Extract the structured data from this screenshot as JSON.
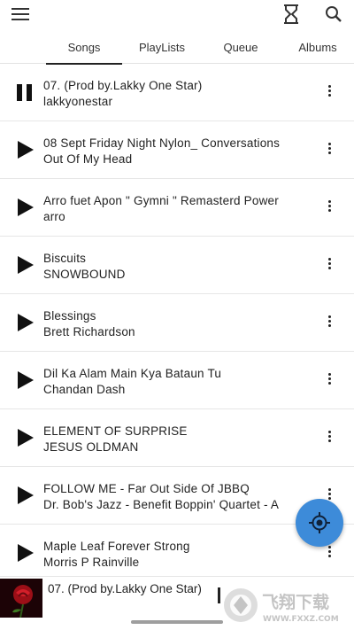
{
  "toolbar": {
    "menu_icon": "menu-icon",
    "timer_icon": "hourglass-icon",
    "search_icon": "search-icon"
  },
  "tabs": [
    {
      "label": "Songs",
      "active": true
    },
    {
      "label": "PlayLists",
      "active": false
    },
    {
      "label": "Queue",
      "active": false
    },
    {
      "label": "Albums",
      "active": false
    }
  ],
  "songs": [
    {
      "title": "07.  (Prod by.Lakky One Star)",
      "artist": "lakkyonestar",
      "state": "playing"
    },
    {
      "title": "08 Sept Friday Night Nylon_ Conversations",
      "artist": "Out Of My Head",
      "state": "paused"
    },
    {
      "title": "Arro fuet Apon \" Gymni \" Remasterd Power",
      "artist": "arro",
      "state": "paused"
    },
    {
      "title": "Biscuits",
      "artist": "SNOWBOUND",
      "state": "paused"
    },
    {
      "title": "Blessings",
      "artist": "Brett Richardson",
      "state": "paused"
    },
    {
      "title": "Dil Ka Alam Main Kya Bataun Tu",
      "artist": "Chandan Dash",
      "state": "paused"
    },
    {
      "title": "ELEMENT OF SURPRISE",
      "artist": "JESUS OLDMAN",
      "state": "paused"
    },
    {
      "title": "FOLLOW ME - Far Out Side Of JBBQ",
      "artist": "Dr. Bob's Jazz - Benefit Boppin' Quartet - A",
      "state": "paused"
    },
    {
      "title": "Maple Leaf Forever Strong",
      "artist": "Morris P Rainville",
      "state": "paused"
    }
  ],
  "now_playing": {
    "title": "07.  (Prod by.Lakky One Star)"
  },
  "fab": {
    "icon": "locate-icon",
    "color": "#3d8bd9"
  },
  "watermark": {
    "brand": "飞翔下载",
    "url": "WWW.FXXZ.COM"
  }
}
